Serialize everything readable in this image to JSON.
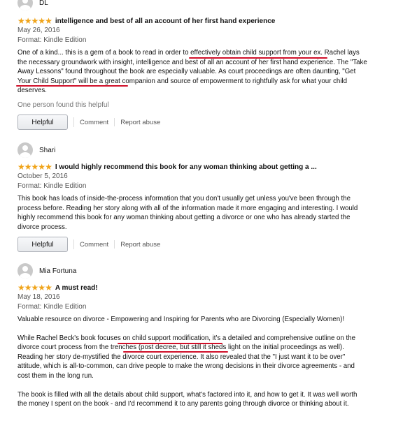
{
  "reviews": [
    {
      "author": "DL",
      "stars": 5,
      "title": "intelligence and best of all an account of her first hand experience",
      "date": "May 26, 2016",
      "format": "Format: Kindle Edition",
      "paragraphs": [
        "One of a kind... this is a gem of a book to read in order to effectively obtain child support from your ex. Rachel lays the necessary groundwork with insight, intelligence and best of all an account of her first hand experience. The \"Take Away Lessons\" found throughout the book are especially valuable. As court proceedings are often daunting, \"Get Your Child Support\" will be a great companion and source of empowerment to rightfully ask for what your child deserves."
      ],
      "helpful_note": "One person found this helpful",
      "helpful_label": "Helpful",
      "comment_label": "Comment",
      "report_label": "Report abuse"
    },
    {
      "author": "Shari",
      "stars": 5,
      "title": "I would highly recommend this book for any woman thinking about getting a ...",
      "date": "October 5, 2016",
      "format": "Format: Kindle Edition",
      "paragraphs": [
        "This book has loads of inside-the-process information that you don't usually get unless you've been through the process before. Reading her story along with all of the information made it more engaging and interesting. I would highly recommend this book for any woman thinking about getting a divorce or one who has already started the divorce process."
      ],
      "helpful_label": "Helpful",
      "comment_label": "Comment",
      "report_label": "Report abuse"
    },
    {
      "author": "Mia Fortuna",
      "stars": 5,
      "title": "A must read!",
      "date": "May 18, 2016",
      "format": "Format: Kindle Edition",
      "paragraphs": [
        "Valuable resource on divorce - Empowering and Inspiring for Parents who are Divorcing (Especially Women)!",
        "While Rachel Beck's book focuses on child support modification, it's a detailed and comprehensive outline on the divorce court process from the trenches (post decree, but still it sheds light on the initial proceedings as well). Reading her story de-mystified the divorce court experience. It also revealed that the \"I just want it to be over\" attitude, which is all-to-common, can drive people to make the wrong decisions in their divorce agreements - and cost them in the long run.",
        "The book is filled with all the details about child support, what's factored into it, and how to get it. It was well worth the money I spent on the book - and I'd recommend it to any parents going through divorce or thinking about it."
      ]
    }
  ],
  "star_color": "#f0a41a",
  "annotation_color": "#d0102a",
  "icons": {
    "avatar": "default-user-avatar-icon",
    "star": "star-icon"
  }
}
